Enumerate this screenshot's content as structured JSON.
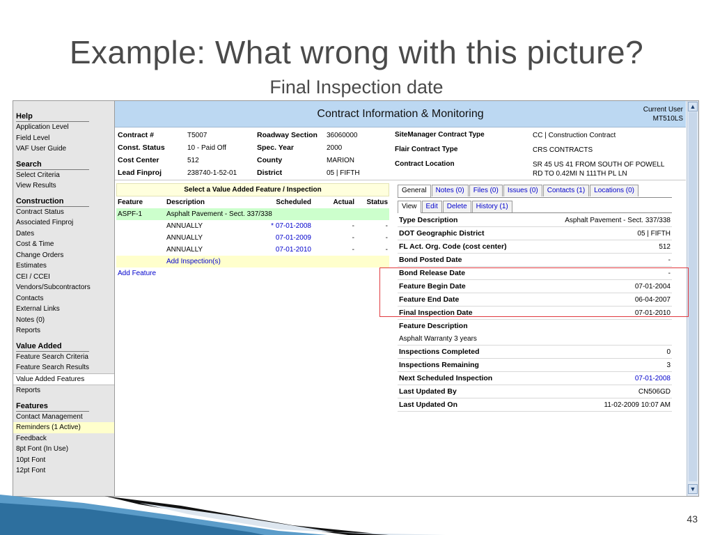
{
  "slide": {
    "title": "Example: What wrong with this picture?",
    "subtitle": "Final Inspection date",
    "page_number": "43"
  },
  "header": {
    "title": "Contract Information & Monitoring",
    "user_label": "Current User",
    "user_id": "MT510LS"
  },
  "sidebar": {
    "sections": [
      {
        "title": "Help",
        "items": [
          "Application Level",
          "Field Level",
          "VAF User Guide"
        ]
      },
      {
        "title": "Search",
        "items": [
          "Select Criteria",
          "View Results"
        ]
      },
      {
        "title": "Construction",
        "items": [
          "Contract Status",
          "Associated Finproj",
          "Dates",
          "Cost & Time",
          "Change Orders",
          "Estimates",
          "CEI / CCEI",
          "Vendors/Subcontractors",
          "Contacts",
          "External Links",
          "Notes (0)",
          "Reports"
        ]
      },
      {
        "title": "Value Added",
        "items": [
          "Feature Search Criteria",
          "Feature Search Results",
          "Value Added Features",
          "Reports"
        ]
      },
      {
        "title": "Features",
        "items": [
          "Contact Management",
          "Reminders (1 Active)",
          "Feedback",
          "8pt Font (In Use)",
          "10pt Font",
          "12pt Font"
        ]
      }
    ]
  },
  "contract": {
    "rows": [
      {
        "l1": "Contract #",
        "v1": "T5007",
        "l2": "Roadway Section",
        "v2": "36060000"
      },
      {
        "l1": "Const. Status",
        "v1": "10 - Paid Off",
        "l2": "Spec. Year",
        "v2": "2000"
      },
      {
        "l1": "Cost Center",
        "v1": "512",
        "l2": "County",
        "v2": "MARION"
      },
      {
        "l1": "Lead Finproj",
        "v1": "238740-1-52-01",
        "l2": "District",
        "v2": "05 | FIFTH"
      }
    ],
    "right": [
      {
        "label": "SiteManager Contract Type",
        "value": "CC | Construction Contract"
      },
      {
        "label": "Flair Contract Type",
        "value": "CRS CONTRACTS"
      },
      {
        "label": "Contract Location",
        "value": "SR 45 US 41 FROM SOUTH OF POWELL",
        "value2": "RD TO 0.42MI N 111TH PL LN"
      }
    ]
  },
  "features": {
    "title": "Select a Value Added Feature / Inspection",
    "columns": [
      "Feature",
      "Description",
      "Scheduled",
      "Actual",
      "Status"
    ],
    "feature_row": {
      "feature": "ASPF-1",
      "description": "Asphalt Pavement - Sect. 337/338"
    },
    "inspections": [
      {
        "description": "ANNUALLY",
        "scheduled": "* 07-01-2008",
        "actual": "-",
        "status": "-"
      },
      {
        "description": "ANNUALLY",
        "scheduled": "07-01-2009",
        "actual": "-",
        "status": "-"
      },
      {
        "description": "ANNUALLY",
        "scheduled": "07-01-2010",
        "actual": "-",
        "status": "-"
      }
    ],
    "add_inspection": "Add Inspection(s)",
    "add_feature": "Add Feature"
  },
  "detail": {
    "tabs": [
      "General",
      "Notes (0)",
      "Files (0)",
      "Issues (0)",
      "Contacts (1)",
      "Locations (0)"
    ],
    "subtabs": [
      "View",
      "Edit",
      "Delete",
      "History (1)"
    ],
    "rows": [
      {
        "label": "Type Description",
        "value": "Asphalt Pavement - Sect. 337/338"
      },
      {
        "label": "DOT Geographic District",
        "value": "05 | FIFTH"
      },
      {
        "label": "FL Act. Org. Code (cost center)",
        "value": "512"
      },
      {
        "label": "Bond Posted Date",
        "value": "-"
      },
      {
        "label": "Bond Release Date",
        "value": "-"
      },
      {
        "label": "Feature Begin Date",
        "value": "07-01-2004"
      },
      {
        "label": "Feature End Date",
        "value": "06-04-2007"
      },
      {
        "label": "Final Inspection Date",
        "value": "07-01-2010"
      }
    ],
    "description_label": "Feature Description",
    "description_value": "Asphalt Warranty 3 years",
    "rows2": [
      {
        "label": "Inspections Completed",
        "value": "0"
      },
      {
        "label": "Inspections Remaining",
        "value": "3"
      },
      {
        "label": "Next Scheduled Inspection",
        "value": "07-01-2008"
      },
      {
        "label": "Last Updated By",
        "value": "CN506GD"
      },
      {
        "label": "Last Updated On",
        "value": "11-02-2009 10:07 AM"
      }
    ]
  },
  "colors": {
    "header_bg": "#bcd8f2",
    "feature_row": "#ccffcc",
    "highlight_row": "#ffffcc",
    "link": "#0000cc",
    "annotation_box": "#e0393e"
  }
}
